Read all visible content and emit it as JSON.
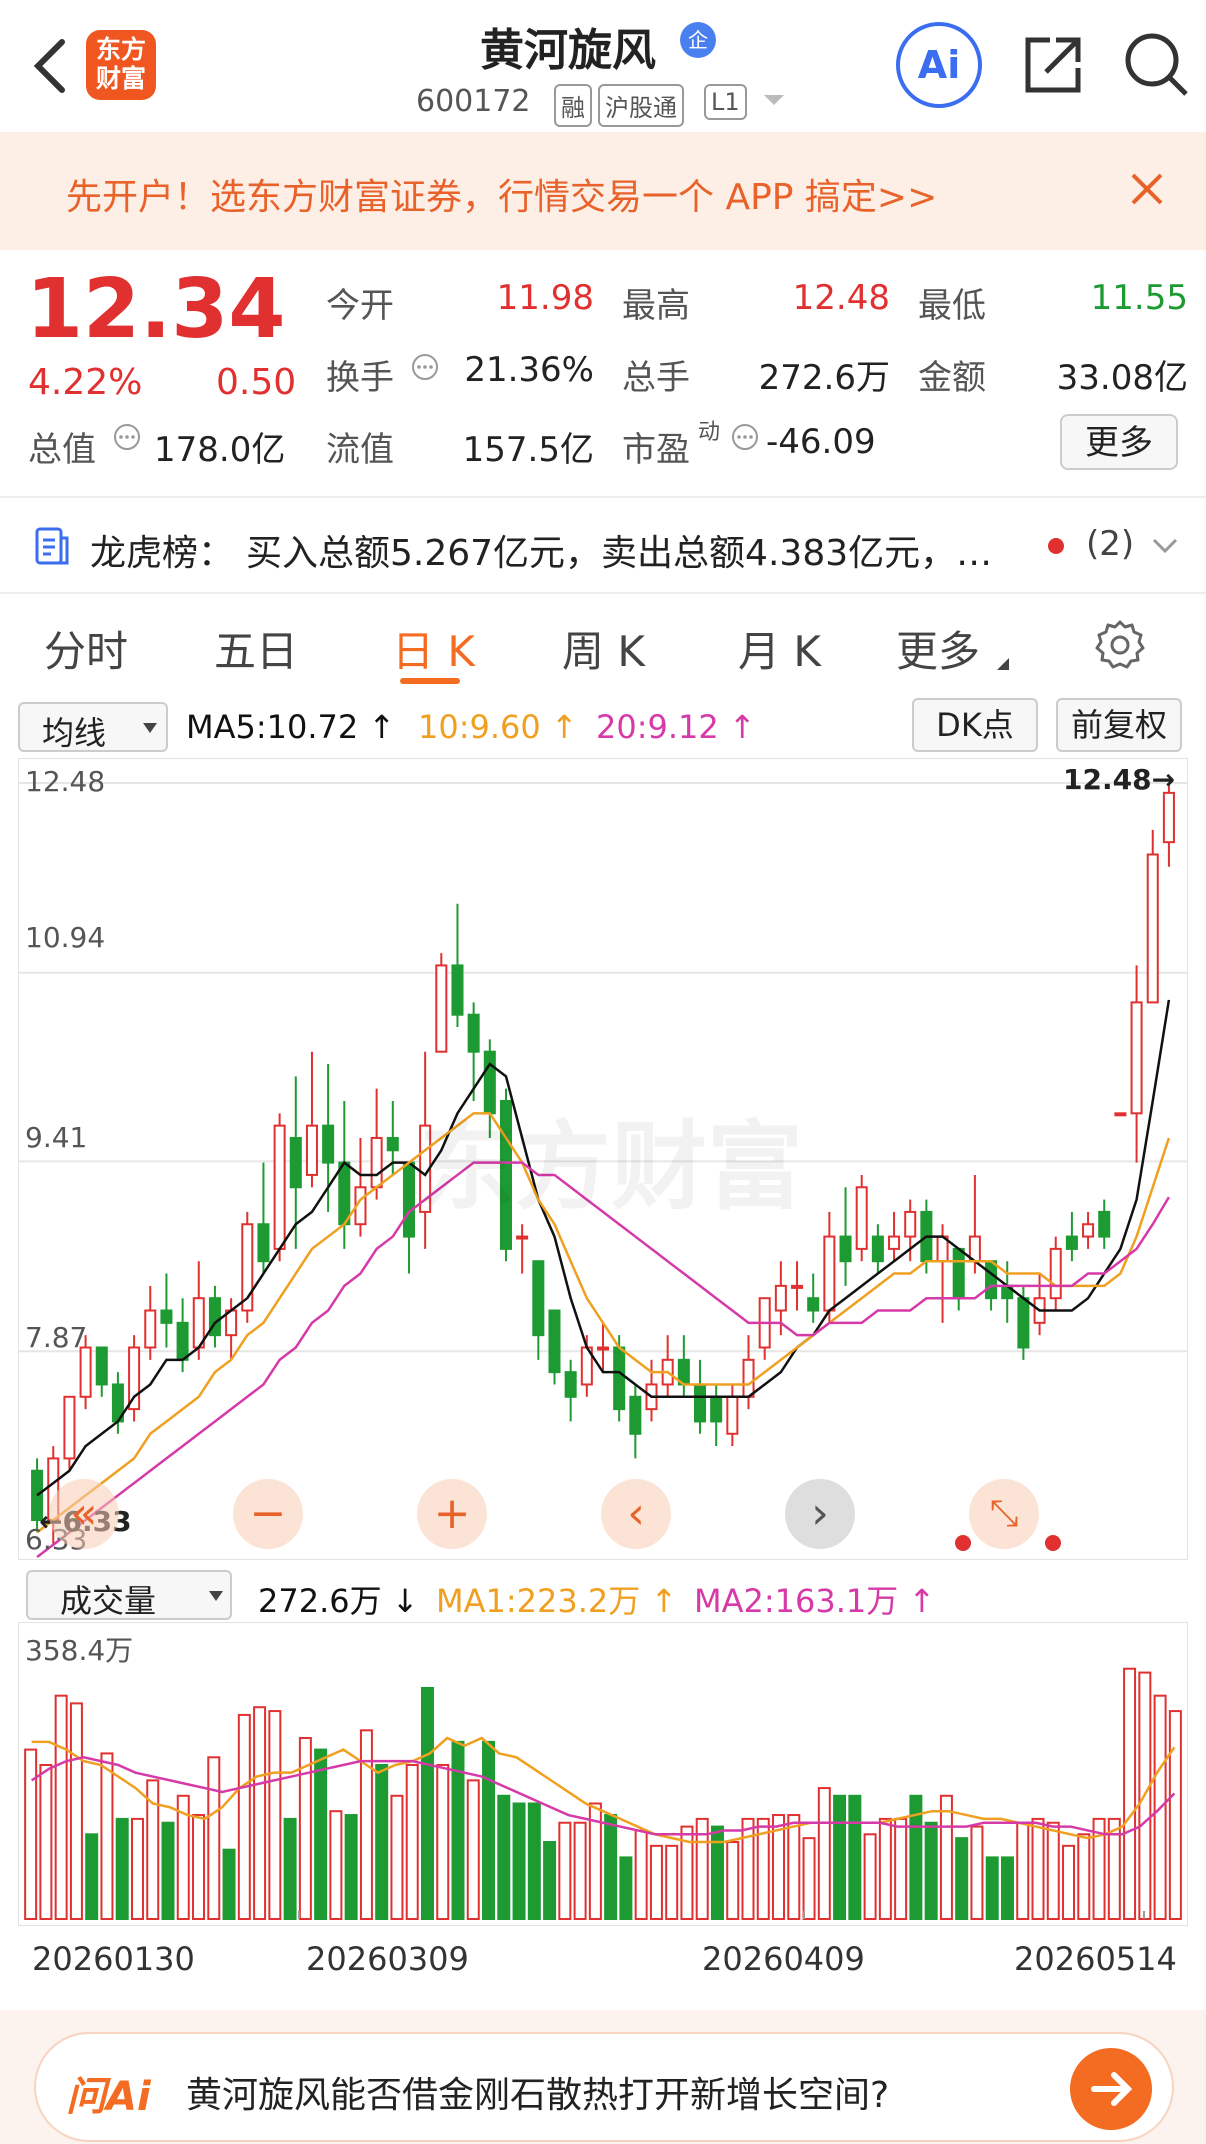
{
  "header": {
    "logo_text": "东方\n财富",
    "stock_name": "黄河旋风",
    "stock_badge": "企",
    "stock_code": "600172",
    "tags": [
      "融",
      "沪股通",
      "L1"
    ],
    "ai_label": "Ai",
    "icons": [
      "back-chevron-icon",
      "share-icon",
      "search-icon"
    ]
  },
  "banner": {
    "text": "先开户！选东方财富证券，行情交易一个 APP 搞定>>",
    "close_icon": "close-icon"
  },
  "quote": {
    "price": "12.34",
    "change_pct": "4.22%",
    "change": "0.50",
    "stats": [
      {
        "label": "今开",
        "value": "11.98",
        "tone": "red"
      },
      {
        "label": "最高",
        "value": "12.48",
        "tone": "red"
      },
      {
        "label": "最低",
        "value": "11.55",
        "tone": "green"
      },
      {
        "label": "换手",
        "value": "21.36%",
        "tone": "dark"
      },
      {
        "label": "总手",
        "value": "272.6万",
        "tone": "dark"
      },
      {
        "label": "金额",
        "value": "33.08亿",
        "tone": "dark"
      },
      {
        "label": "总值",
        "value": "178.0亿",
        "tone": "dark"
      },
      {
        "label": "流值",
        "value": "157.5亿",
        "tone": "dark"
      },
      {
        "label": "市盈",
        "sup": "动",
        "value": "-46.09",
        "tone": "dark"
      }
    ],
    "more_button": "更多"
  },
  "dragon": {
    "label": "龙虎榜：",
    "text": "买入总额5.267亿元，卖出总额4.383亿元，…",
    "count": "(2)"
  },
  "tabs": [
    "分时",
    "五日",
    "日 K",
    "周 K",
    "月 K",
    "更多"
  ],
  "active_tab": 2,
  "ma_bar": {
    "select": "均线",
    "ma5": "MA5:10.72",
    "ma10": "10:9.60",
    "ma20": "20:9.12",
    "dk_button": "DK点",
    "adjust_button": "前复权"
  },
  "colors": {
    "up": "#e0302f",
    "down": "#1e9a32",
    "ma5": "#111111",
    "ma10": "#f0a020",
    "ma20": "#d63aa8",
    "accent": "#f36c21"
  },
  "chart_data": {
    "type": "candlestick",
    "y_ticks": [
      "12.48",
      "10.94",
      "9.41",
      "7.87",
      "6.33"
    ],
    "ylim": [
      6.33,
      12.48
    ],
    "max_label": "12.48",
    "min_label": "6.33",
    "candles": [
      [
        6.9,
        6.5,
        7.0,
        6.4
      ],
      [
        6.5,
        7.0,
        7.1,
        6.3
      ],
      [
        7.0,
        7.5,
        7.5,
        6.9
      ],
      [
        7.5,
        7.9,
        8.0,
        7.4
      ],
      [
        7.9,
        7.6,
        7.9,
        7.5
      ],
      [
        7.6,
        7.3,
        7.7,
        7.2
      ],
      [
        7.4,
        7.9,
        8.0,
        7.3
      ],
      [
        7.9,
        8.2,
        8.4,
        7.8
      ],
      [
        8.2,
        8.1,
        8.5,
        7.9
      ],
      [
        8.1,
        7.8,
        8.3,
        7.7
      ],
      [
        7.9,
        8.3,
        8.6,
        7.8
      ],
      [
        8.3,
        8.0,
        8.4,
        7.9
      ],
      [
        8.0,
        8.2,
        8.3,
        7.8
      ],
      [
        8.2,
        8.9,
        9.0,
        8.1
      ],
      [
        8.9,
        8.6,
        9.4,
        8.5
      ],
      [
        8.7,
        9.7,
        9.8,
        8.6
      ],
      [
        9.6,
        9.2,
        10.1,
        8.7
      ],
      [
        9.3,
        9.7,
        10.3,
        9.2
      ],
      [
        9.7,
        9.4,
        10.2,
        9.0
      ],
      [
        9.4,
        8.9,
        9.9,
        8.7
      ],
      [
        8.9,
        9.2,
        9.6,
        8.8
      ],
      [
        9.2,
        9.6,
        10.0,
        9.1
      ],
      [
        9.6,
        9.5,
        9.9,
        9.3
      ],
      [
        9.4,
        8.8,
        9.4,
        8.5
      ],
      [
        9.0,
        9.7,
        10.3,
        8.7
      ],
      [
        10.3,
        11.0,
        11.1,
        10.3
      ],
      [
        11.0,
        10.6,
        11.5,
        10.5
      ],
      [
        10.6,
        10.3,
        10.7,
        9.9
      ],
      [
        10.3,
        9.8,
        10.4,
        9.6
      ],
      [
        9.9,
        8.7,
        10.0,
        8.6
      ],
      [
        8.8,
        8.8,
        8.9,
        8.5
      ],
      [
        8.6,
        8.0,
        8.6,
        7.8
      ],
      [
        8.2,
        7.7,
        8.2,
        7.6
      ],
      [
        7.7,
        7.5,
        7.8,
        7.3
      ],
      [
        7.6,
        7.9,
        8.0,
        7.5
      ],
      [
        7.9,
        7.9,
        8.1,
        7.7
      ],
      [
        7.9,
        7.4,
        8.0,
        7.3
      ],
      [
        7.5,
        7.2,
        7.6,
        7.0
      ],
      [
        7.4,
        7.6,
        7.8,
        7.3
      ],
      [
        7.6,
        7.8,
        8.0,
        7.5
      ],
      [
        7.8,
        7.6,
        8.0,
        7.5
      ],
      [
        7.6,
        7.3,
        7.8,
        7.2
      ],
      [
        7.5,
        7.3,
        7.6,
        7.1
      ],
      [
        7.2,
        7.5,
        7.6,
        7.1
      ],
      [
        7.5,
        7.8,
        8.0,
        7.4
      ],
      [
        7.9,
        8.3,
        8.3,
        7.8
      ],
      [
        8.2,
        8.4,
        8.6,
        8.0
      ],
      [
        8.4,
        8.4,
        8.6,
        8.2
      ],
      [
        8.3,
        8.2,
        8.5,
        8.1
      ],
      [
        8.2,
        8.8,
        9.0,
        8.1
      ],
      [
        8.8,
        8.6,
        9.2,
        8.4
      ],
      [
        8.7,
        9.2,
        9.3,
        8.6
      ],
      [
        8.8,
        8.6,
        8.9,
        8.5
      ],
      [
        8.7,
        8.8,
        9.0,
        8.6
      ],
      [
        8.8,
        9.0,
        9.1,
        8.6
      ],
      [
        9.0,
        8.6,
        9.1,
        8.5
      ],
      [
        8.6,
        8.8,
        8.9,
        8.1
      ],
      [
        8.7,
        8.3,
        8.7,
        8.2
      ],
      [
        8.6,
        8.8,
        9.3,
        8.5
      ],
      [
        8.6,
        8.3,
        8.6,
        8.2
      ],
      [
        8.4,
        8.3,
        8.6,
        8.1
      ],
      [
        8.3,
        7.9,
        8.4,
        7.8
      ],
      [
        8.1,
        8.3,
        8.5,
        8.0
      ],
      [
        8.3,
        8.7,
        8.8,
        8.2
      ],
      [
        8.8,
        8.7,
        9.0,
        8.6
      ],
      [
        8.8,
        8.9,
        9.0,
        8.7
      ],
      [
        9.0,
        8.8,
        9.1,
        8.7
      ],
      [
        9.8,
        9.8,
        9.8,
        9.8
      ],
      [
        9.8,
        10.7,
        11.0,
        9.4
      ],
      [
        10.7,
        11.9,
        12.1,
        10.7
      ],
      [
        12.0,
        12.4,
        12.48,
        11.8
      ]
    ],
    "ma5": [
      6.7,
      6.8,
      6.9,
      7.1,
      7.2,
      7.3,
      7.5,
      7.6,
      7.8,
      7.8,
      7.9,
      8.1,
      8.2,
      8.3,
      8.5,
      8.7,
      8.9,
      9.0,
      9.2,
      9.4,
      9.3,
      9.3,
      9.4,
      9.4,
      9.3,
      9.5,
      9.8,
      10.0,
      10.2,
      10.1,
      9.6,
      9.1,
      8.8,
      8.3,
      7.9,
      7.7,
      7.7,
      7.6,
      7.5,
      7.5,
      7.5,
      7.5,
      7.5,
      7.5,
      7.5,
      7.6,
      7.7,
      7.9,
      8.0,
      8.2,
      8.3,
      8.4,
      8.5,
      8.6,
      8.7,
      8.8,
      8.8,
      8.7,
      8.6,
      8.5,
      8.4,
      8.3,
      8.2,
      8.2,
      8.2,
      8.3,
      8.5,
      8.7,
      9.1,
      9.9,
      10.72
    ],
    "ma10": [
      6.4,
      6.5,
      6.6,
      6.7,
      6.8,
      6.9,
      7.0,
      7.2,
      7.3,
      7.4,
      7.5,
      7.7,
      7.8,
      8.0,
      8.1,
      8.3,
      8.5,
      8.7,
      8.8,
      8.9,
      9.1,
      9.2,
      9.3,
      9.4,
      9.5,
      9.6,
      9.7,
      9.8,
      9.8,
      9.6,
      9.4,
      9.1,
      8.9,
      8.6,
      8.3,
      8.1,
      7.9,
      7.8,
      7.7,
      7.7,
      7.6,
      7.6,
      7.6,
      7.6,
      7.6,
      7.7,
      7.8,
      7.9,
      8.0,
      8.1,
      8.2,
      8.3,
      8.4,
      8.5,
      8.5,
      8.6,
      8.6,
      8.6,
      8.6,
      8.6,
      8.5,
      8.5,
      8.5,
      8.4,
      8.4,
      8.4,
      8.4,
      8.5,
      8.8,
      9.2,
      9.6
    ],
    "ma20": [
      6.2,
      6.3,
      6.4,
      6.5,
      6.6,
      6.7,
      6.8,
      6.9,
      7.0,
      7.1,
      7.2,
      7.3,
      7.4,
      7.5,
      7.6,
      7.8,
      7.9,
      8.1,
      8.2,
      8.4,
      8.5,
      8.7,
      8.8,
      9.0,
      9.1,
      9.2,
      9.3,
      9.4,
      9.4,
      9.4,
      9.4,
      9.3,
      9.3,
      9.2,
      9.1,
      9.0,
      8.9,
      8.8,
      8.7,
      8.6,
      8.5,
      8.4,
      8.3,
      8.2,
      8.1,
      8.1,
      8.1,
      8.0,
      8.0,
      8.1,
      8.1,
      8.1,
      8.2,
      8.2,
      8.2,
      8.3,
      8.3,
      8.3,
      8.3,
      8.4,
      8.4,
      8.4,
      8.4,
      8.4,
      8.4,
      8.5,
      8.5,
      8.6,
      8.7,
      8.9,
      9.12
    ]
  },
  "controls": [
    "rewind-icon",
    "zoom-out-icon",
    "zoom-in-icon",
    "prev-icon",
    "next-icon",
    "fullscreen-icon"
  ],
  "volume": {
    "select": "成交量",
    "current": "272.6万",
    "ma1": "MA1:223.2万",
    "ma2": "MA2:163.1万",
    "max_label": "358.4万",
    "dates": [
      "20260130",
      "20260309",
      "20260409",
      "20260514"
    ],
    "chart_data": {
      "type": "bar",
      "ylim": [
        0,
        358.4
      ],
      "values": [
        220,
        200,
        290,
        280,
        110,
        215,
        130,
        130,
        180,
        125,
        160,
        135,
        210,
        90,
        265,
        275,
        270,
        130,
        235,
        220,
        140,
        135,
        245,
        200,
        160,
        200,
        300,
        200,
        230,
        180,
        230,
        160,
        150,
        150,
        100,
        125,
        125,
        150,
        135,
        80,
        115,
        95,
        95,
        120,
        130,
        120,
        100,
        130,
        130,
        135,
        135,
        105,
        170,
        160,
        160,
        110,
        130,
        130,
        160,
        125,
        160,
        105,
        120,
        80,
        80,
        125,
        130,
        125,
        95,
        110,
        130,
        130,
        325,
        320,
        290,
        270
      ],
      "up": [
        1,
        1,
        1,
        1,
        0,
        1,
        0,
        1,
        1,
        0,
        1,
        1,
        1,
        0,
        1,
        1,
        1,
        0,
        1,
        0,
        1,
        0,
        1,
        0,
        1,
        1,
        0,
        1,
        0,
        1,
        0,
        0,
        0,
        0,
        0,
        1,
        1,
        1,
        0,
        0,
        1,
        1,
        1,
        1,
        1,
        0,
        1,
        1,
        1,
        1,
        1,
        1,
        1,
        0,
        0,
        1,
        1,
        1,
        0,
        0,
        1,
        0,
        1,
        0,
        0,
        1,
        1,
        1,
        1,
        1,
        1,
        1,
        1,
        1,
        1,
        1
      ],
      "ma1": [
        230,
        230,
        220,
        205,
        200,
        185,
        170,
        150,
        145,
        135,
        130,
        145,
        170,
        185,
        190,
        190,
        200,
        210,
        220,
        205,
        190,
        200,
        205,
        215,
        235,
        225,
        235,
        215,
        210,
        195,
        180,
        165,
        150,
        140,
        130,
        120,
        110,
        105,
        100,
        100,
        100,
        105,
        110,
        115,
        120,
        125,
        125,
        125,
        125,
        125,
        130,
        135,
        140,
        140,
        135,
        130,
        130,
        125,
        120,
        115,
        110,
        105,
        110,
        120,
        150,
        190,
        223
      ],
      "ma2": [
        180,
        195,
        205,
        210,
        205,
        200,
        190,
        185,
        180,
        175,
        170,
        165,
        170,
        175,
        180,
        185,
        190,
        195,
        200,
        205,
        205,
        205,
        205,
        200,
        195,
        190,
        185,
        175,
        165,
        155,
        145,
        135,
        130,
        125,
        120,
        115,
        110,
        110,
        110,
        110,
        115,
        115,
        120,
        120,
        125,
        125,
        125,
        125,
        125,
        125,
        120,
        120,
        120,
        120,
        120,
        125,
        125,
        125,
        125,
        120,
        120,
        115,
        110,
        110,
        120,
        140,
        163
      ]
    }
  },
  "ask_ai": {
    "brand": "问Ai",
    "question": "黄河旋风能否借金刚石散热打开新增长空间?"
  }
}
